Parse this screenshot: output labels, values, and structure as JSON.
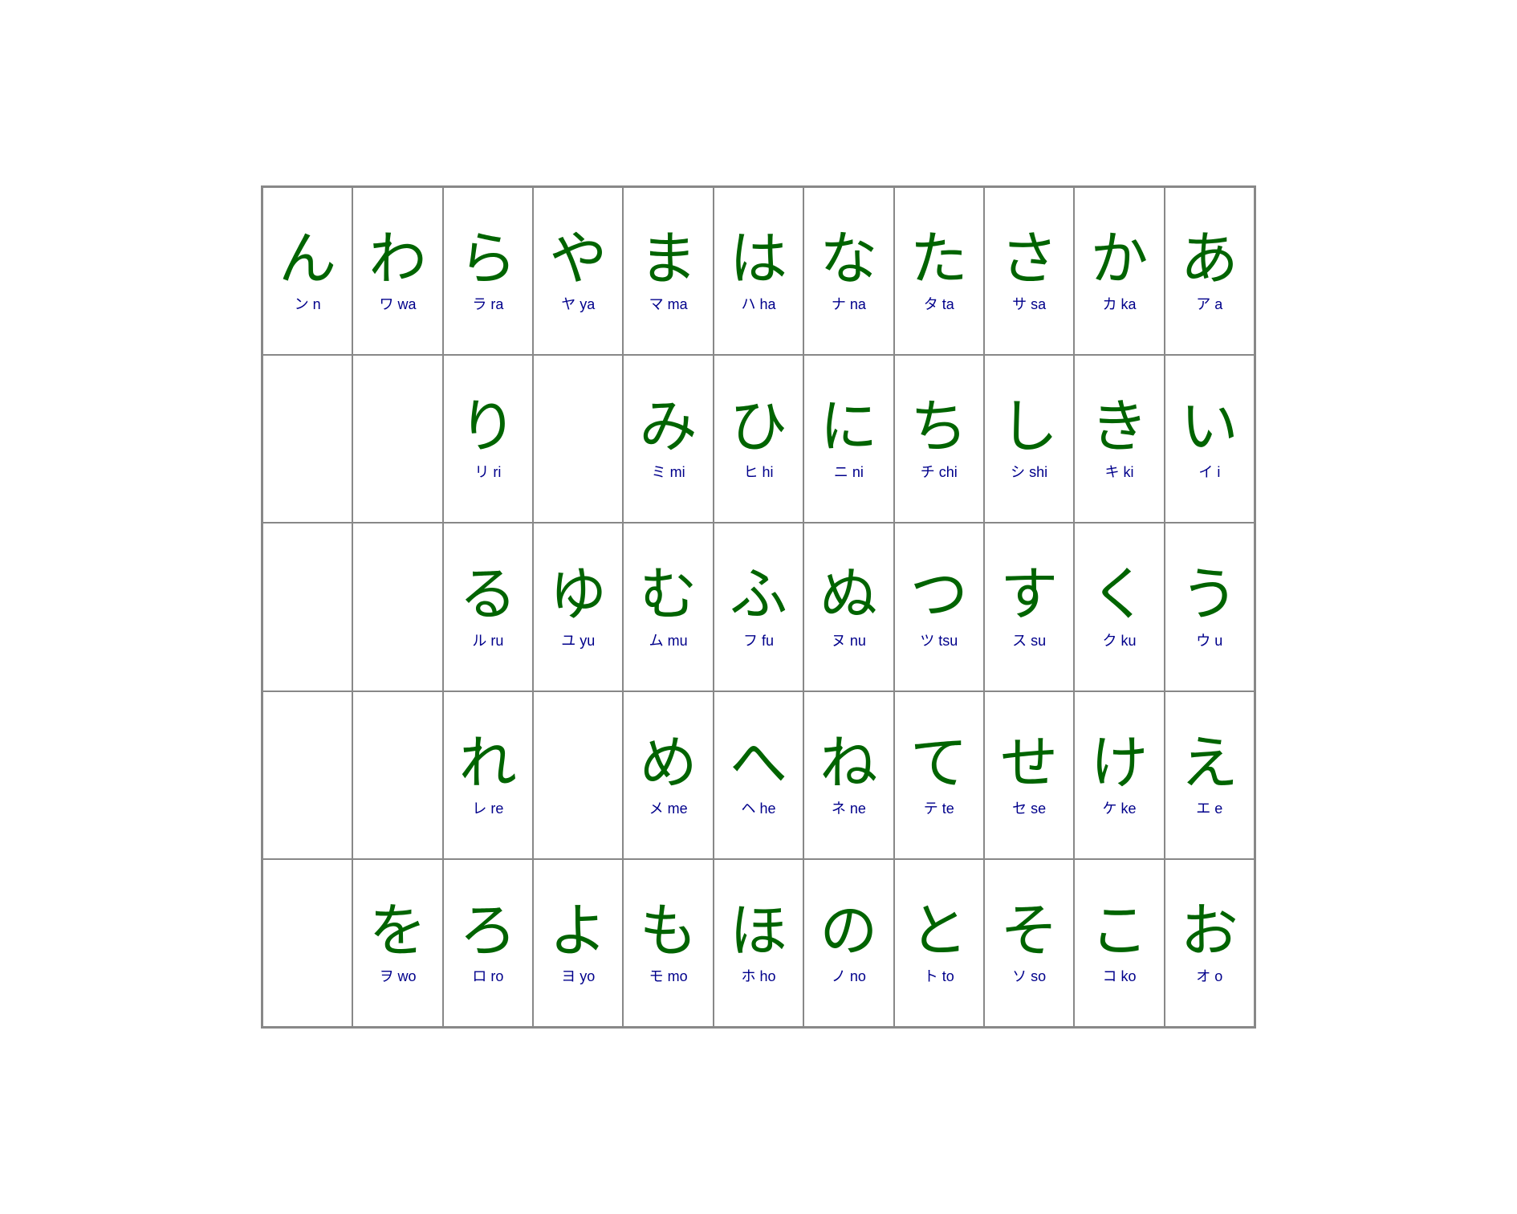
{
  "cells": [
    {
      "hiragana": "ん",
      "label": "ン n"
    },
    {
      "hiragana": "わ",
      "label": "ワ wa"
    },
    {
      "hiragana": "ら",
      "label": "ラ ra"
    },
    {
      "hiragana": "や",
      "label": "ヤ ya"
    },
    {
      "hiragana": "ま",
      "label": "マ ma"
    },
    {
      "hiragana": "は",
      "label": "ハ ha"
    },
    {
      "hiragana": "な",
      "label": "ナ na"
    },
    {
      "hiragana": "た",
      "label": "タ ta"
    },
    {
      "hiragana": "さ",
      "label": "サ sa"
    },
    {
      "hiragana": "か",
      "label": "カ ka"
    },
    {
      "hiragana": "あ",
      "label": "ア a"
    },
    {
      "hiragana": "",
      "label": ""
    },
    {
      "hiragana": "",
      "label": ""
    },
    {
      "hiragana": "り",
      "label": "リ ri"
    },
    {
      "hiragana": "",
      "label": ""
    },
    {
      "hiragana": "み",
      "label": "ミ mi"
    },
    {
      "hiragana": "ひ",
      "label": "ヒ hi"
    },
    {
      "hiragana": "に",
      "label": "ニ ni"
    },
    {
      "hiragana": "ち",
      "label": "チ chi"
    },
    {
      "hiragana": "し",
      "label": "シ shi"
    },
    {
      "hiragana": "き",
      "label": "キ ki"
    },
    {
      "hiragana": "い",
      "label": "イ i"
    },
    {
      "hiragana": "",
      "label": ""
    },
    {
      "hiragana": "",
      "label": ""
    },
    {
      "hiragana": "る",
      "label": "ル ru"
    },
    {
      "hiragana": "ゆ",
      "label": "ユ yu"
    },
    {
      "hiragana": "む",
      "label": "ム mu"
    },
    {
      "hiragana": "ふ",
      "label": "フ fu"
    },
    {
      "hiragana": "ぬ",
      "label": "ヌ nu"
    },
    {
      "hiragana": "つ",
      "label": "ツ tsu"
    },
    {
      "hiragana": "す",
      "label": "ス su"
    },
    {
      "hiragana": "く",
      "label": "ク ku"
    },
    {
      "hiragana": "う",
      "label": "ウ u"
    },
    {
      "hiragana": "",
      "label": ""
    },
    {
      "hiragana": "",
      "label": ""
    },
    {
      "hiragana": "れ",
      "label": "レ re"
    },
    {
      "hiragana": "",
      "label": ""
    },
    {
      "hiragana": "め",
      "label": "メ me"
    },
    {
      "hiragana": "へ",
      "label": "ヘ he"
    },
    {
      "hiragana": "ね",
      "label": "ネ ne"
    },
    {
      "hiragana": "て",
      "label": "テ te"
    },
    {
      "hiragana": "せ",
      "label": "セ se"
    },
    {
      "hiragana": "け",
      "label": "ケ ke"
    },
    {
      "hiragana": "え",
      "label": "エ e"
    },
    {
      "hiragana": "",
      "label": ""
    },
    {
      "hiragana": "を",
      "label": "ヲ wo"
    },
    {
      "hiragana": "ろ",
      "label": "ロ ro"
    },
    {
      "hiragana": "よ",
      "label": "ヨ yo"
    },
    {
      "hiragana": "も",
      "label": "モ mo"
    },
    {
      "hiragana": "ほ",
      "label": "ホ ho"
    },
    {
      "hiragana": "の",
      "label": "ノ no"
    },
    {
      "hiragana": "と",
      "label": "ト to"
    },
    {
      "hiragana": "そ",
      "label": "ソ so"
    },
    {
      "hiragana": "こ",
      "label": "コ ko"
    },
    {
      "hiragana": "お",
      "label": "オ o"
    }
  ]
}
